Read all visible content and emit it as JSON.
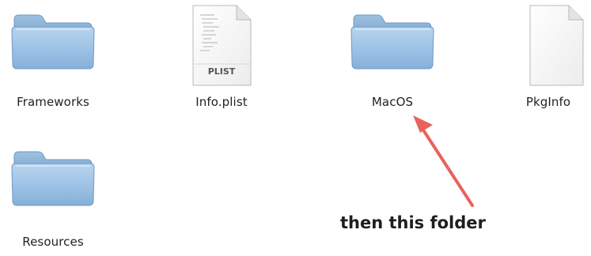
{
  "finder": {
    "items": [
      {
        "label": "Frameworks",
        "kind": "folder-icon"
      },
      {
        "label": "Info.plist",
        "kind": "plist-file-icon",
        "badge": "PLIST"
      },
      {
        "label": "MacOS",
        "kind": "folder-icon"
      },
      {
        "label": "PkgInfo",
        "kind": "generic-file-icon"
      },
      {
        "label": "Resources",
        "kind": "folder-icon"
      }
    ]
  },
  "annotation": {
    "text": "then this folder",
    "arrow_color": "#e8635b"
  }
}
